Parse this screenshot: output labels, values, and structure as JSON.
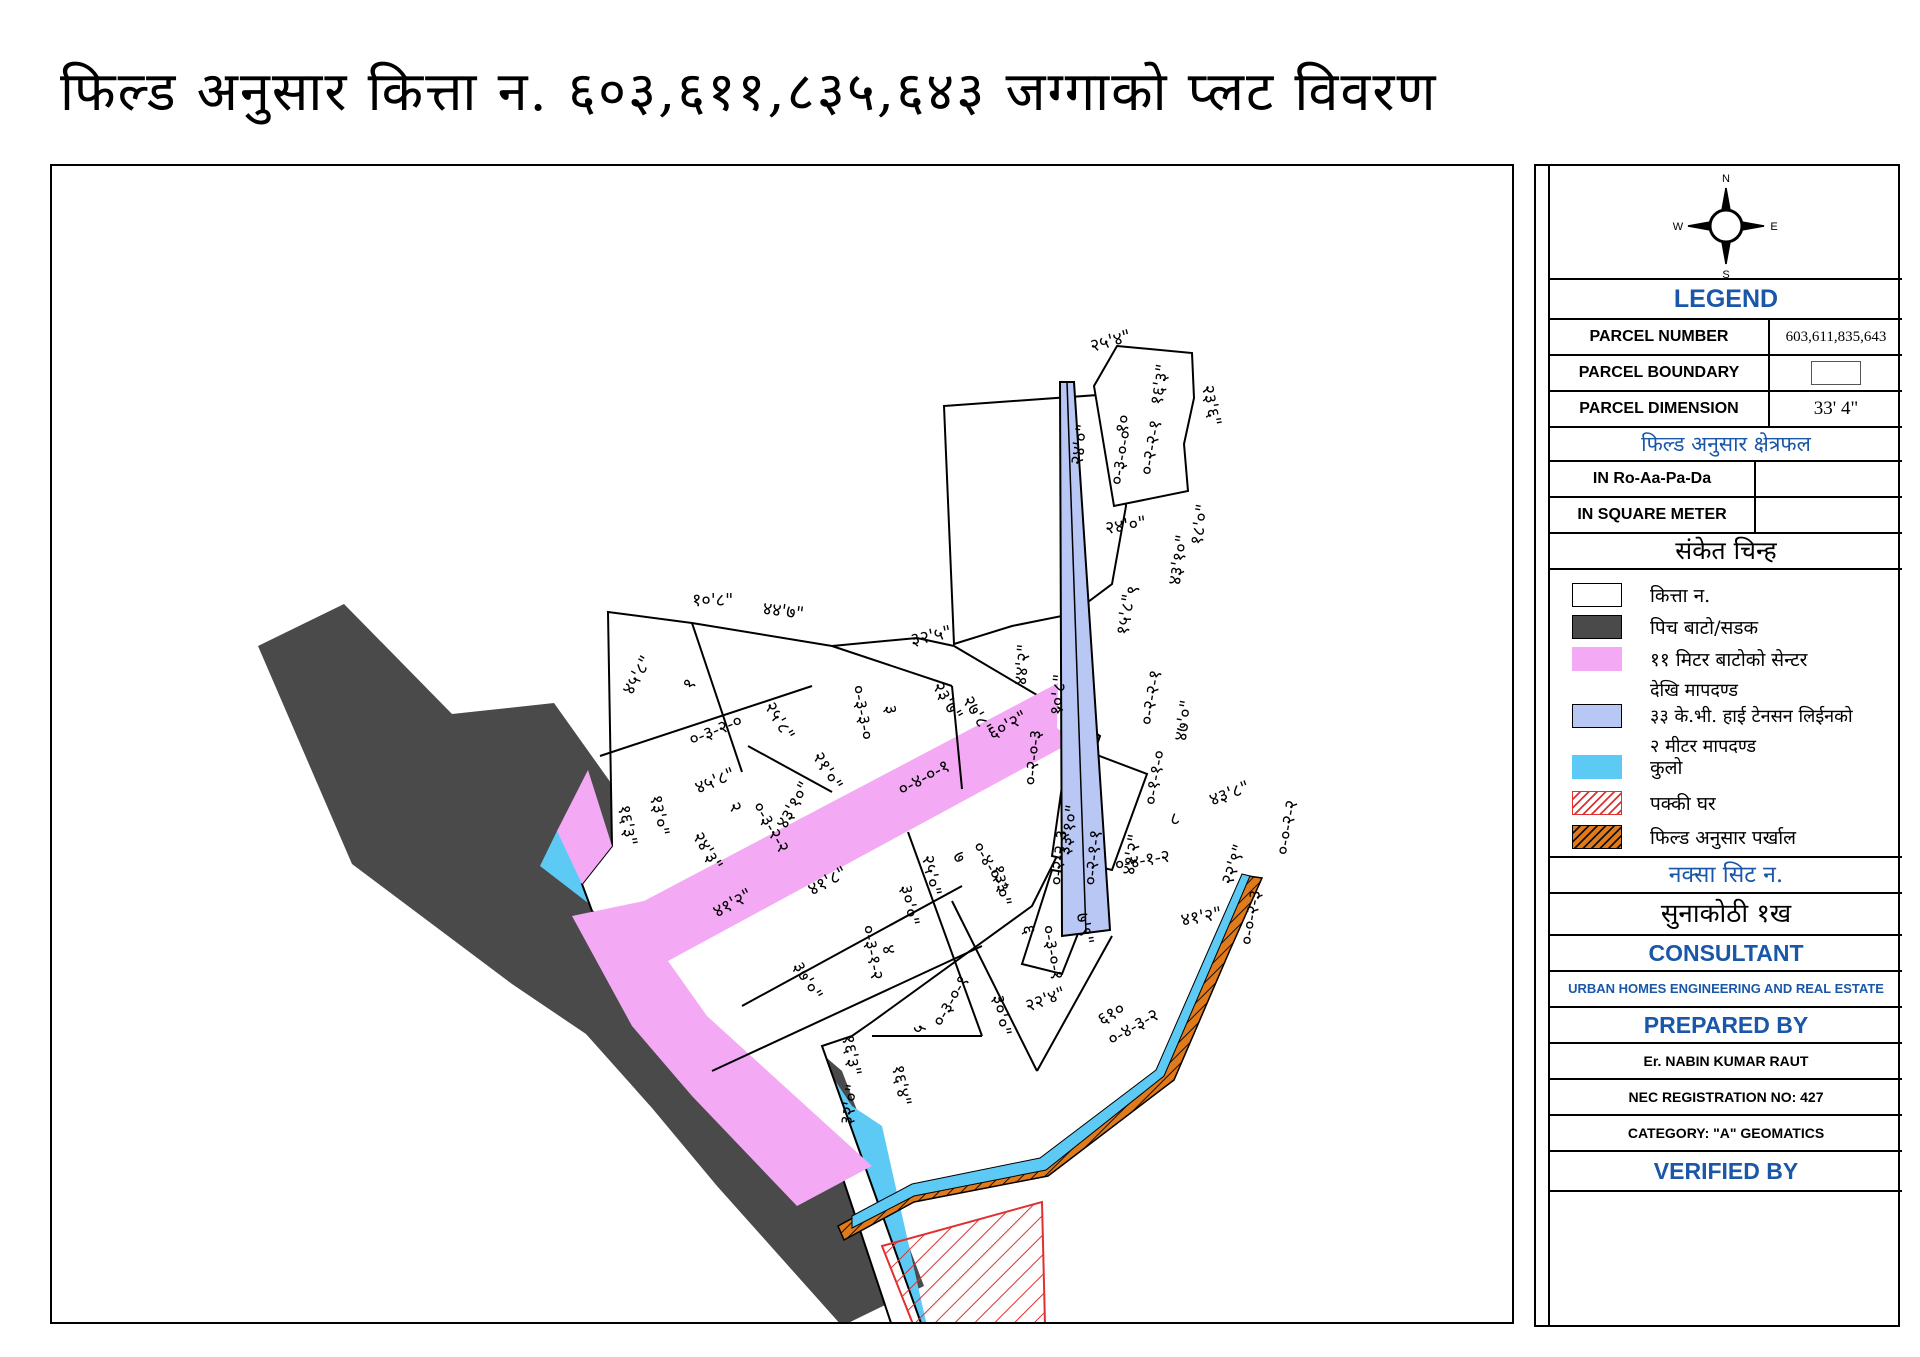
{
  "title": "फिल्ड अनुसार कित्ता न. ६०३,६११,८३५,६४३ जग्गाको प्लट विवरण",
  "colors": {
    "road": "#4a4a4a",
    "road_center_setback": "#f4a9f4",
    "hightension_setback": "#b9c7f5",
    "kulo": "#5ccaf5",
    "pakki_ghar": "#e03030",
    "parkhal": "#e07a1a",
    "legend_blue": "#1a57a8"
  },
  "compass": {
    "n": "N",
    "e": "E",
    "s": "S",
    "w": "W"
  },
  "legend": {
    "heading": "LEGEND",
    "parcel_number_label": "PARCEL NUMBER",
    "parcel_number_value": "603,611,835,643",
    "parcel_boundary_label": "PARCEL BOUNDARY",
    "parcel_dimension_label": "PARCEL DIMENSION",
    "parcel_dimension_value": "33' 4\"",
    "area_heading": "फिल्ड अनुसार क्षेत्रफल",
    "ropani_label": "IN Ro-Aa-Pa-Da",
    "sqm_label": "IN SQUARE METER",
    "symbols_heading": "संकेत चिन्ह",
    "symbols": [
      {
        "label": "कित्ता न.",
        "icon": "parcel-swatch"
      },
      {
        "label": "पिच बाटो/सडक",
        "icon": "road-swatch"
      },
      {
        "label": "११ मिटर बाटोको सेन्टर",
        "label2": "देखि मापदण्ड",
        "icon": "road-setback-swatch"
      },
      {
        "label": "३३ के.भी. हाई टेनसन लिईनको",
        "label2": "२ मीटर मापदण्ड",
        "icon": "hightension-swatch"
      },
      {
        "label": "कुलो",
        "icon": "kulo-swatch"
      },
      {
        "label": "पक्की घर",
        "icon": "house-swatch"
      },
      {
        "label": "फिल्ड अनुसार पर्खाल",
        "icon": "wall-swatch"
      }
    ],
    "sheet_heading": "नक्सा सिट न.",
    "sheet_value": "सुनाकोठी १ख",
    "consultant_heading": "CONSULTANT",
    "consultant_value": "URBAN HOMES ENGINEERING AND REAL ESTATE",
    "prepared_heading": "PREPARED BY",
    "prepared_name": "Er. NABIN KUMAR RAUT",
    "nec_reg": "NEC REGISTRATION NO:  427",
    "category": "CATEGORY:  \"A\" GEOMATICS",
    "verified_heading": "VERIFIED BY"
  },
  "plots": [
    {
      "no": "१",
      "area": "०-३-२-०"
    },
    {
      "no": "२",
      "area": "०-३-२-२"
    },
    {
      "no": "३",
      "area": "०-३-३-०"
    },
    {
      "no": "४",
      "area": "०-३-१-२"
    },
    {
      "no": "५",
      "area": "०-३-०-१"
    },
    {
      "no": "६",
      "area": "०-३-०-१"
    },
    {
      "no": "७",
      "area": "०-४-०-३"
    },
    {
      "no": "८",
      "area": "०-४-१-२"
    },
    {
      "no": "९",
      "area": "०-२-२-१"
    },
    {
      "no": "१०",
      "area": "०-३-०-०"
    },
    {
      "no": "६१०",
      "area": "०-४-३-२"
    }
  ],
  "road_parcels": [
    {
      "area": "०-४-०-१"
    },
    {
      "area": "०-२-२-३"
    },
    {
      "area": "०-२-१-१"
    },
    {
      "area": "०-१-१-०"
    },
    {
      "area": "०-२-२-०"
    },
    {
      "area": "०-२-०-३"
    },
    {
      "area": "०-०-२-२"
    },
    {
      "area": "०-०-२-३"
    }
  ],
  "dimensions": [
    "२५'४\"",
    "१६'३\"",
    "२३'६\"",
    "३२'०\"",
    "२४'०\"",
    "१८'०\"",
    "२४'०\"",
    "४३'१०\"",
    "१५'८\"",
    "४७'०\"",
    "३७'१०\"",
    "४४'२\"",
    "१०'८\"",
    "४४'७\"",
    "३२'५\"",
    "४५'८\"",
    "४५'८\"",
    "२५'८\"",
    "२१'०\"",
    "२३'७\"",
    "२७'८\"",
    "२०'०\"",
    "१६'३\"",
    "१३'०\"",
    "२४'३\"",
    "४३'१०\"",
    "६०'२\"",
    "४१'८\"",
    "४१'२\"",
    "१३'०\"",
    "२५'०\"",
    "३०'०\"",
    "३७'०\"",
    "३०'०\"",
    "२२'४\"",
    "३३'१०\"",
    "४१'२\"",
    "२२'९\"",
    "४३'८\"",
    "१२'०\"",
    "१६'४\"",
    "३२'०\"",
    "१२'२\"",
    "७'९\"",
    "३६'१०\"",
    "१५'०\"",
    "१३'६\""
  ]
}
